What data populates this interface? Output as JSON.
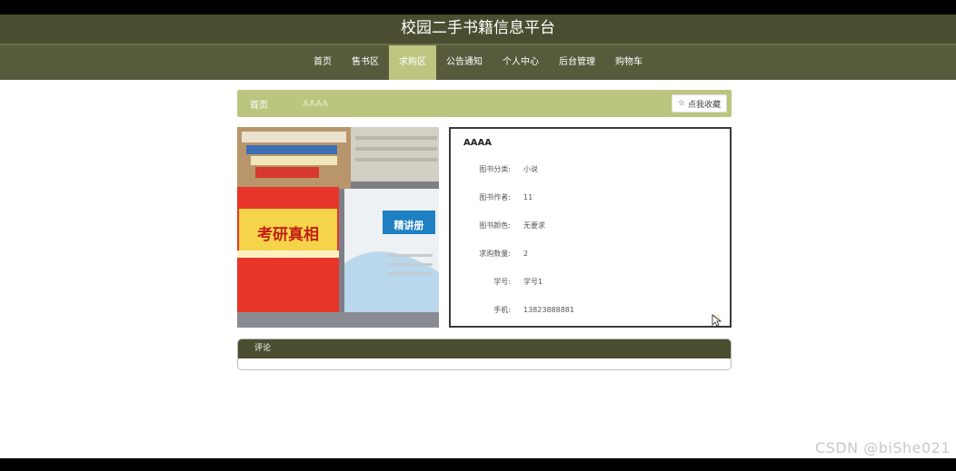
{
  "header": {
    "title": "校园二手书籍信息平台"
  },
  "nav": {
    "items": [
      {
        "label": "首页"
      },
      {
        "label": "售书区"
      },
      {
        "label": "求购区"
      },
      {
        "label": "公告通知"
      },
      {
        "label": "个人中心"
      },
      {
        "label": "后台管理"
      },
      {
        "label": "购物车"
      }
    ],
    "active_index": 2
  },
  "breadcrumb": {
    "home": "首页",
    "current": "AAAA"
  },
  "favorite_button": {
    "label": "点我收藏",
    "icon": "star-icon"
  },
  "detail": {
    "title": "AAAA",
    "rows": [
      {
        "label": "图书分类:",
        "value": "小说"
      },
      {
        "label": "图书作者:",
        "value": "11"
      },
      {
        "label": "图书颜色:",
        "value": "无要求"
      },
      {
        "label": "求购数量:",
        "value": "2"
      },
      {
        "label": "学号:",
        "value": "学号1"
      },
      {
        "label": "手机:",
        "value": "13823888881"
      }
    ]
  },
  "comment": {
    "title": "评论"
  },
  "watermark": "CSDN @biShe021",
  "photo": {
    "book1_title": "考研真相",
    "book2_title": "精讲册"
  },
  "colors": {
    "header": "#4a4d2f",
    "nav": "#585a3c",
    "accent": "#bdc580"
  }
}
